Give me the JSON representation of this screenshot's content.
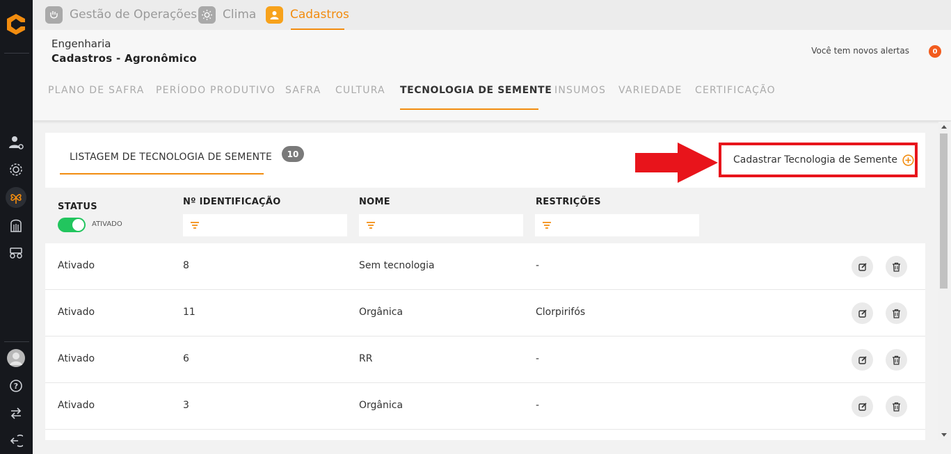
{
  "modules": [
    {
      "label": "Gestão de Operações",
      "icon": "hand-icon",
      "active": false
    },
    {
      "label": "Clima",
      "icon": "sun-icon",
      "active": false
    },
    {
      "label": "Cadastros",
      "icon": "user-icon",
      "active": true
    }
  ],
  "header": {
    "breadcrumb_parent": "Engenharia",
    "breadcrumb_current": "Cadastros - Agronômico",
    "alerts_text": "Você tem novos alertas",
    "alerts_count": "0"
  },
  "subtabs": [
    {
      "label": "PLANO DE SAFRA",
      "active": false
    },
    {
      "label": "PERÍODO PRODUTIVO",
      "active": false
    },
    {
      "label": "SAFRA",
      "active": false
    },
    {
      "label": "CULTURA",
      "active": false
    },
    {
      "label": "TECNOLOGIA DE SEMENTE",
      "active": true
    },
    {
      "label": "INSUMOS",
      "active": false
    },
    {
      "label": "VARIEDADE",
      "active": false
    },
    {
      "label": "CERTIFICAÇÃO",
      "active": false
    }
  ],
  "listing": {
    "title": "LISTAGEM DE TECNOLOGIA DE SEMENTE",
    "count": "10",
    "add_label": "Cadastrar Tecnologia de Semente"
  },
  "table": {
    "headers": {
      "status": "STATUS",
      "id": "Nº IDENTIFICAÇÃO",
      "name": "NOME",
      "restrictions": "RESTRIÇÕES"
    },
    "status_toggle_label": "ATIVADO",
    "status_toggle_on": true,
    "rows": [
      {
        "status": "Ativado",
        "id": "8",
        "name": "Sem tecnologia",
        "restrictions": "-"
      },
      {
        "status": "Ativado",
        "id": "11",
        "name": "Orgânica",
        "restrictions": "Clorpirifós"
      },
      {
        "status": "Ativado",
        "id": "6",
        "name": "RR",
        "restrictions": "-"
      },
      {
        "status": "Ativado",
        "id": "3",
        "name": "Orgânica",
        "restrictions": "-"
      }
    ]
  },
  "colors": {
    "accent": "#f28c0f",
    "sidebar_bg": "#16181d",
    "highlight_red": "#e8141b",
    "toggle_on": "#22c55e",
    "badge": "#f25c1e"
  }
}
